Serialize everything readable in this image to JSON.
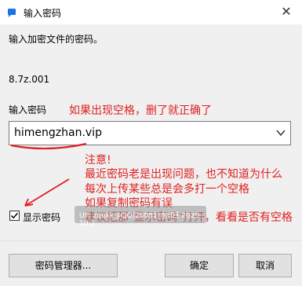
{
  "window": {
    "title": "输入密码",
    "close_glyph": "✕"
  },
  "prompt": "输入加密文件的密码。",
  "filename": "8.7z.001",
  "password_label": "输入密码",
  "password_value": "himengzhan.vip",
  "show_password": {
    "label": "显示密码",
    "checked": true,
    "check_glyph": "✓"
  },
  "buttons": {
    "manager": "密码管理器...",
    "ok": "确定",
    "cancel": "取消"
  },
  "watermark": "UP: zoukk@QQ(26081)水印于2025-10-2",
  "annotations": {
    "space_note": "如果出现空格，删了就正确了",
    "notice": [
      "注意!",
      "最近密码老是出现问题，也不知道为什么",
      "每次上传某些总是会多打一个空格",
      "如果复制密码有误",
      "建议把那\"显示密码\"打开，看看是否有空格"
    ]
  },
  "colors": {
    "annotation": "#e02020",
    "window_bg": "#f0f0f0",
    "titlebar_bg": "#ffffff",
    "app_icon": "#1a73e8"
  },
  "icons": {
    "app": "app-icon",
    "close": "close-icon",
    "dropdown": "chevron-down-icon"
  }
}
